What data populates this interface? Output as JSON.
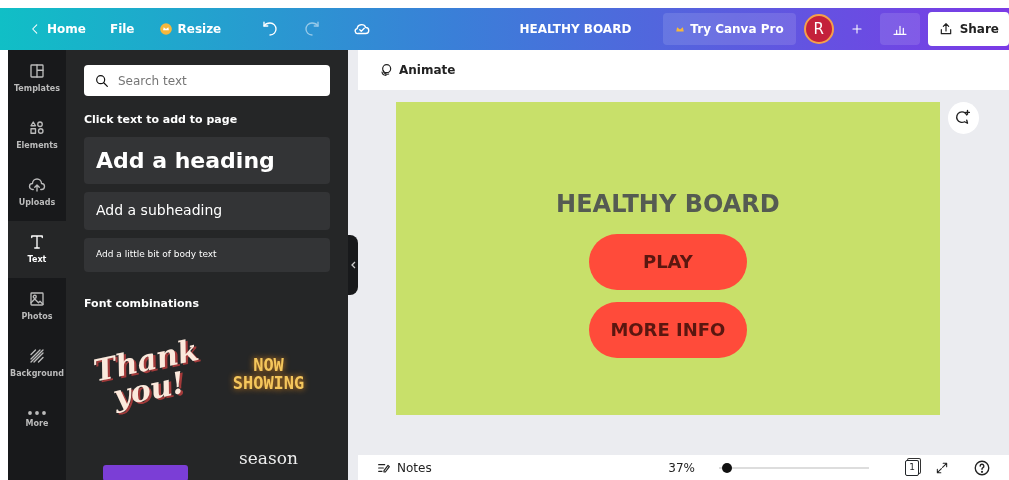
{
  "topbar": {
    "back": "Home",
    "menu": [
      {
        "label": "File",
        "kind": "plain"
      },
      {
        "label": "Resize",
        "kind": "badge"
      }
    ],
    "title": "HEALTHY BOARD",
    "pro_button": "Try Canva Pro",
    "avatar": "R",
    "share": "Share"
  },
  "rail": [
    {
      "label": "Templates",
      "selected": false
    },
    {
      "label": "Elements",
      "selected": false
    },
    {
      "label": "Uploads",
      "selected": false
    },
    {
      "label": "Text",
      "selected": true
    },
    {
      "label": "Photos",
      "selected": false
    },
    {
      "label": "Background",
      "selected": false
    },
    {
      "label": "More",
      "selected": false
    }
  ],
  "panel": {
    "search_placeholder": "Search text",
    "hint": "Click text to add to page",
    "text_styles": [
      {
        "kind": "heading",
        "label": "Add a heading"
      },
      {
        "kind": "subheading",
        "label": "Add a subheading"
      },
      {
        "kind": "body",
        "label": "Add a little bit of body text"
      }
    ],
    "section": "Font combinations",
    "previews": [
      {
        "kind": "script",
        "text": "Thank you!"
      },
      {
        "kind": "neon",
        "text": "NOW SHOWING"
      },
      {
        "kind": "graphic"
      },
      {
        "kind": "serif",
        "text": "season"
      }
    ]
  },
  "toolbar": {
    "animate": "Animate"
  },
  "board": {
    "title": "HEALTHY BOARD",
    "buttons": [
      "PLAY",
      "MORE INFO"
    ]
  },
  "footer": {
    "notes": "Notes",
    "zoom": "37%",
    "level": 0.05,
    "page": "1"
  }
}
